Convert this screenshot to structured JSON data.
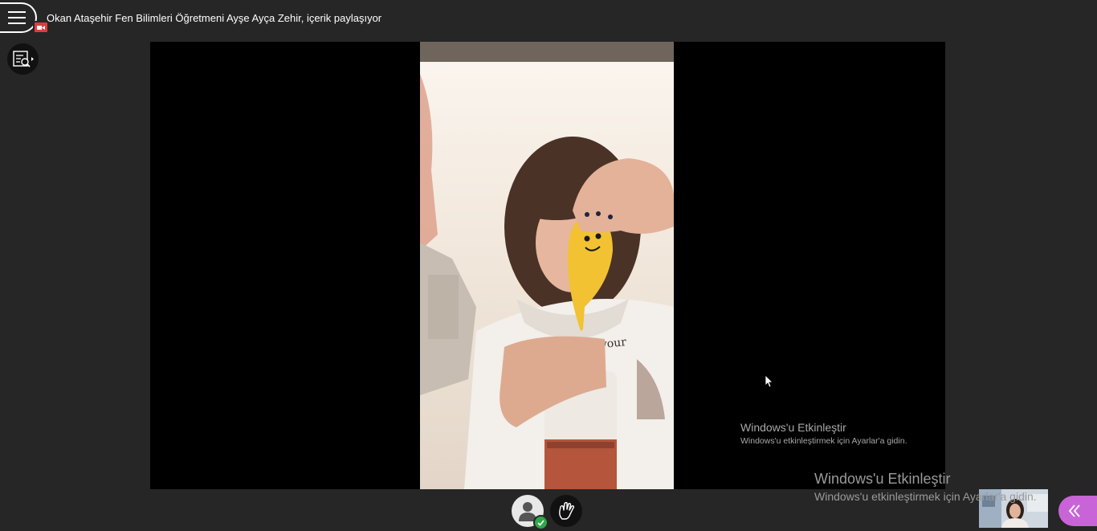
{
  "header": {
    "session_title": "Okan Ataşehir Fen Bilimleri Öğretmeni Ayşe Ayça Zehir, içerik paylaşıyor"
  },
  "icons": {
    "menu": "hamburger-menu-icon",
    "camera": "camera-icon",
    "captions": "captions-search-icon",
    "cursor": "mouse-cursor-icon",
    "avatar": "user-avatar-icon",
    "status": "check-icon",
    "raise_hand": "raise-hand-icon",
    "collaborate": "double-chevron-left-icon"
  },
  "activation_watermark_inner": {
    "heading": "Windows'u Etkinleştir",
    "subtext": "Windows'u etkinleştirmek için Ayarlar'a gidin."
  },
  "activation_watermark_outer": {
    "heading": "Windows'u Etkinleştir",
    "subtext": "Windows'u etkinleştirmek için Ayarlar'a gidin."
  },
  "colors": {
    "background": "#262626",
    "stage": "#000000",
    "accent_panel": "#c964d8",
    "camera_badge": "#e23b3b",
    "status_ok": "#2ea84a"
  }
}
